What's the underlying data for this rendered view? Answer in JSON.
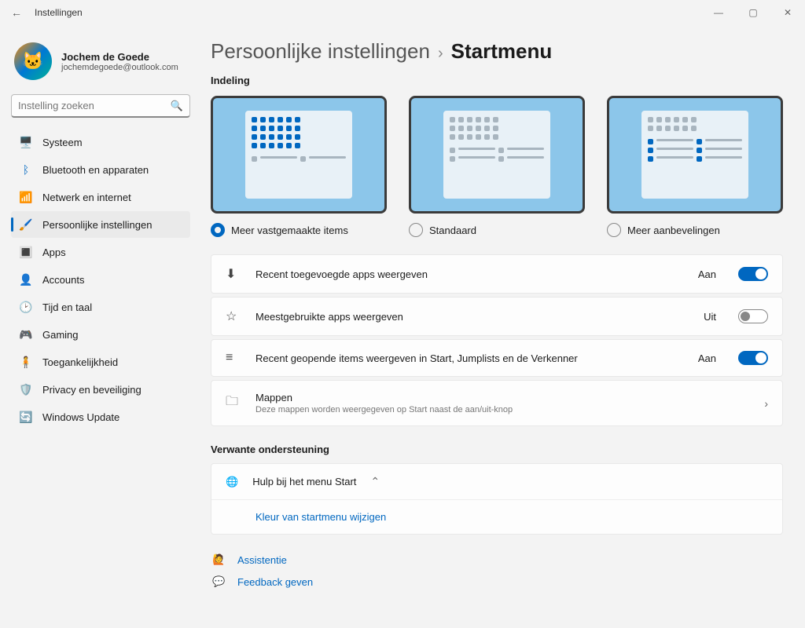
{
  "window": {
    "title": "Instellingen"
  },
  "user": {
    "name": "Jochem de Goede",
    "email": "jochemdegoede@outlook.com"
  },
  "search": {
    "placeholder": "Instelling zoeken"
  },
  "nav": [
    {
      "label": "Systeem"
    },
    {
      "label": "Bluetooth en apparaten"
    },
    {
      "label": "Netwerk en internet"
    },
    {
      "label": "Persoonlijke instellingen"
    },
    {
      "label": "Apps"
    },
    {
      "label": "Accounts"
    },
    {
      "label": "Tijd en taal"
    },
    {
      "label": "Gaming"
    },
    {
      "label": "Toegankelijkheid"
    },
    {
      "label": "Privacy en beveiliging"
    },
    {
      "label": "Windows Update"
    }
  ],
  "breadcrumb": {
    "parent": "Persoonlijke instellingen",
    "current": "Startmenu"
  },
  "layout": {
    "heading": "Indeling",
    "options": [
      {
        "label": "Meer vastgemaakte items",
        "selected": true
      },
      {
        "label": "Standaard",
        "selected": false
      },
      {
        "label": "Meer aanbevelingen",
        "selected": false
      }
    ]
  },
  "toggles": {
    "recent_apps": {
      "label": "Recent toegevoegde apps weergeven",
      "state": "Aan",
      "on": true
    },
    "most_used": {
      "label": "Meestgebruikte apps weergeven",
      "state": "Uit",
      "on": false
    },
    "recent_items": {
      "label": "Recent geopende items weergeven in Start, Jumplists en de Verkenner",
      "state": "Aan",
      "on": true
    }
  },
  "folders": {
    "title": "Mappen",
    "desc": "Deze mappen worden weergegeven op Start naast de aan/uit-knop"
  },
  "related": {
    "heading": "Verwante ondersteuning",
    "help_title": "Hulp bij het menu Start",
    "link1": "Kleur van startmenu wijzigen"
  },
  "footer": {
    "assist": "Assistentie",
    "feedback": "Feedback geven"
  }
}
